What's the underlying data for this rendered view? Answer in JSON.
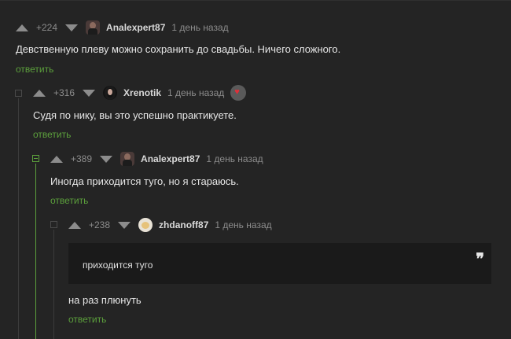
{
  "reply_label": "ответить",
  "comments": [
    {
      "rating": "+224",
      "author": "Analexpert87",
      "time": "1 день назад",
      "text": "Девственную плеву можно сохранить до свадьбы. Ничего сложного.",
      "avatar": "man-avatar"
    },
    {
      "rating": "+316",
      "author": "Xrenotik",
      "time": "1 день назад",
      "text": "Судя по нику, вы это успешно практикуете.",
      "avatar": "girl-avatar",
      "badge": "heart-badge-icon"
    },
    {
      "rating": "+389",
      "author": "Analexpert87",
      "time": "1 день назад",
      "text": "Иногда приходится туго, но я стараюсь.",
      "avatar": "man-avatar"
    },
    {
      "rating": "+238",
      "author": "zhdanoff87",
      "time": "1 день назад",
      "quote": "приходится туго",
      "text": "на раз плюнуть",
      "avatar": "pet-avatar"
    }
  ],
  "colors": {
    "background": "#242424",
    "reply": "#5ca03c",
    "muted": "#8c8c8c",
    "quote_bg": "#1a1a1a"
  }
}
